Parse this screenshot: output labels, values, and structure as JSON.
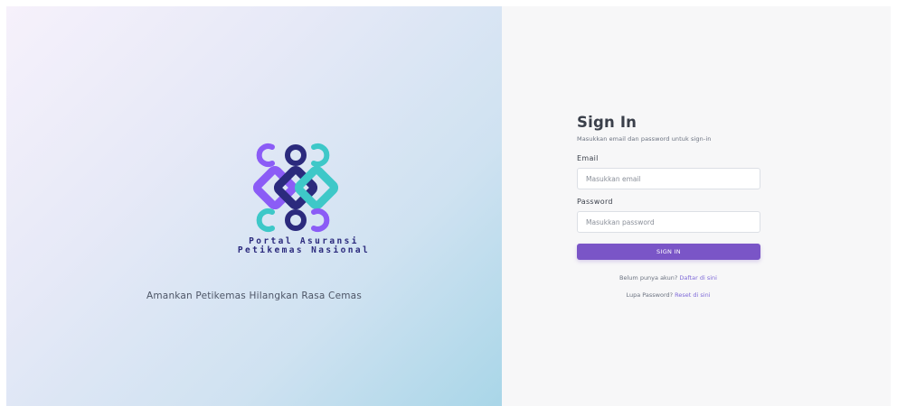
{
  "branding": {
    "line1": "Portal Asuransi",
    "line2": "Petikemas Nasional",
    "tagline": "Amankan Petikemas Hilangkan Rasa Cemas",
    "colors": {
      "navy": "#2b2a7d",
      "purple": "#8b5cf6",
      "teal": "#3ec8c8"
    }
  },
  "form": {
    "title": "Sign In",
    "subtitle": "Masukkan email dan password untuk sign-in",
    "email_label": "Email",
    "email_placeholder": "Masukkan email",
    "email_value": "",
    "password_label": "Password",
    "password_placeholder": "Masukkan password",
    "password_value": "",
    "submit_label": "SIGN IN",
    "accent_color": "#7a55c7"
  },
  "links": {
    "register_prompt": "Belum punya akun?",
    "register_link": "Daftar di sini",
    "forgot_prompt": "Lupa Password?",
    "forgot_link": "Reset di sini"
  }
}
